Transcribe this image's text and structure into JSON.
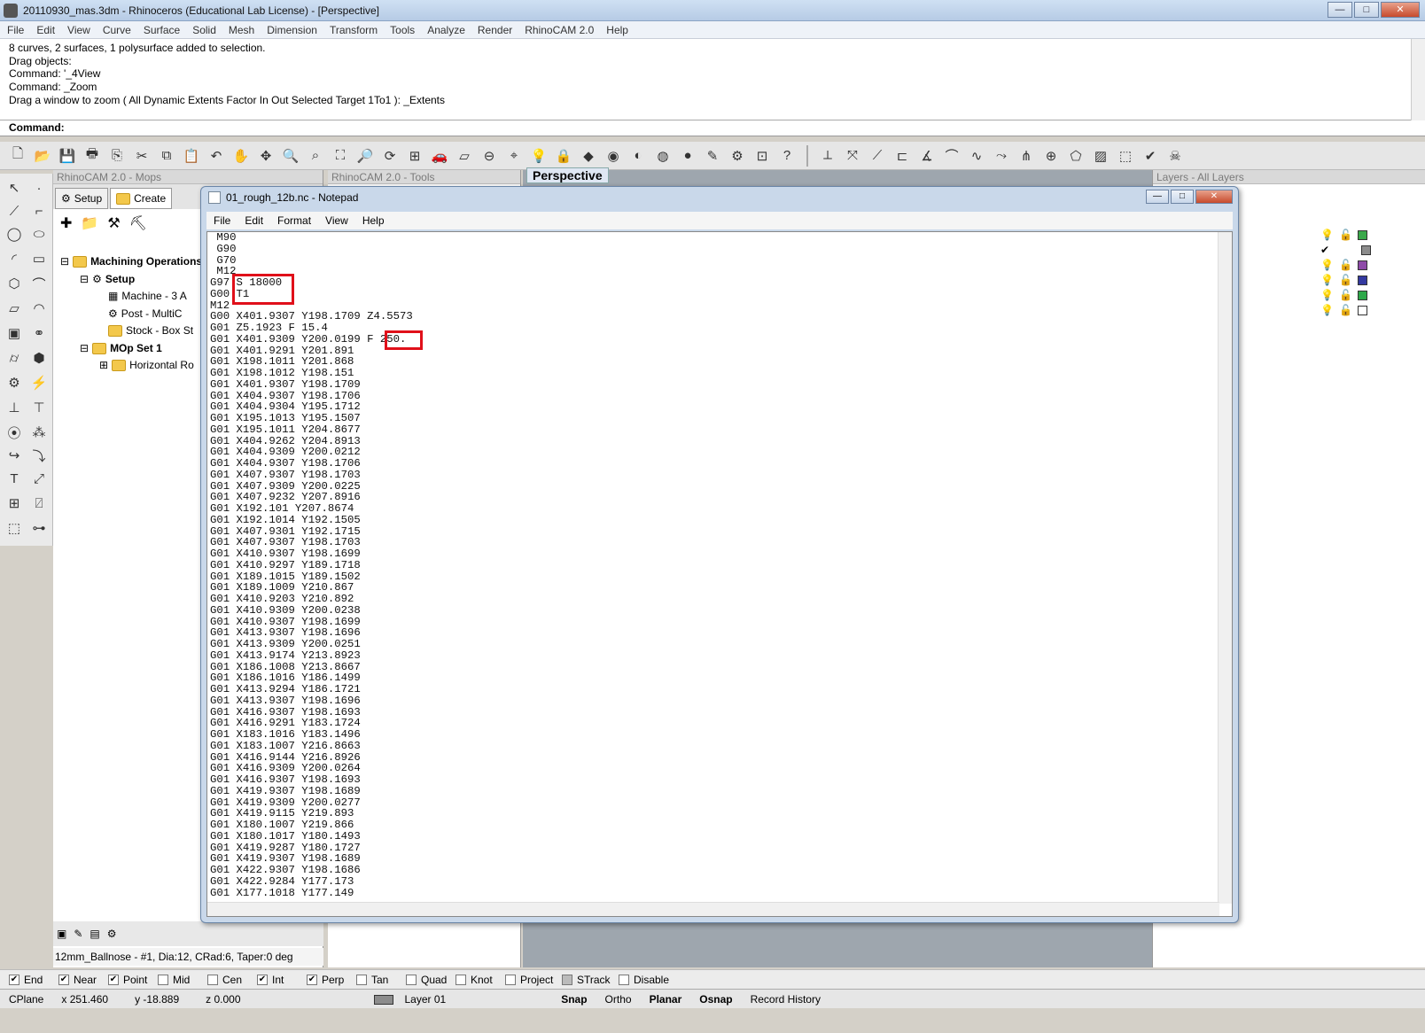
{
  "window": {
    "title": "20110930_mas.3dm - Rhinoceros (Educational Lab License) - [Perspective]",
    "min": "—",
    "max": "□",
    "close": "✕"
  },
  "menu": [
    "File",
    "Edit",
    "View",
    "Curve",
    "Surface",
    "Solid",
    "Mesh",
    "Dimension",
    "Transform",
    "Tools",
    "Analyze",
    "Render",
    "RhinoCAM 2.0",
    "Help"
  ],
  "history": [
    "8 curves, 2 surfaces, 1 polysurface added to selection.",
    "Drag objects:",
    "Command: '_4View",
    "Command: _Zoom",
    "Drag a window to zoom ( All  Dynamic  Extents  Factor  In  Out  Selected  Target  1To1 ): _Extents"
  ],
  "command_label": "Command:",
  "panels": {
    "mops": "RhinoCAM 2.0 - Mops",
    "tools": "RhinoCAM 2.0 - Tools",
    "layers": "Layers - All Layers",
    "viewport": "Perspective"
  },
  "mops_tabs": [
    "Setup",
    "Create"
  ],
  "tree": [
    {
      "label": "Machining Operations",
      "bold": true
    },
    {
      "label": "Setup",
      "bold": true
    },
    {
      "label": "Machine - 3 A"
    },
    {
      "label": "Post - MultiC"
    },
    {
      "label": "Stock - Box St"
    },
    {
      "label": "MOp Set 1",
      "bold": true
    },
    {
      "label": "Horizontal Ro"
    }
  ],
  "tool_info": "12mm_Ballnose - #1, Dia:12, CRad:6, Taper:0 deg",
  "notepad": {
    "title": "01_rough_12b.nc - Notepad",
    "menu": [
      "File",
      "Edit",
      "Format",
      "View",
      "Help"
    ],
    "lines": [
      " M90",
      " G90",
      " G70",
      " M12",
      "G97 S 18000",
      "G00 T1",
      "M12",
      "G00 X401.9307 Y198.1709 Z4.5573",
      "G01 Z5.1923 F 15.4",
      "G01 X401.9309 Y200.0199 F 250.",
      "G01 X401.9291 Y201.891",
      "G01 X198.1011 Y201.868",
      "G01 X198.1012 Y198.151",
      "G01 X401.9307 Y198.1709",
      "G01 X404.9307 Y198.1706",
      "G01 X404.9304 Y195.1712",
      "G01 X195.1013 Y195.1507",
      "G01 X195.1011 Y204.8677",
      "G01 X404.9262 Y204.8913",
      "G01 X404.9309 Y200.0212",
      "G01 X404.9307 Y198.1706",
      "G01 X407.9307 Y198.1703",
      "G01 X407.9309 Y200.0225",
      "G01 X407.9232 Y207.8916",
      "G01 X192.101 Y207.8674",
      "G01 X192.1014 Y192.1505",
      "G01 X407.9301 Y192.1715",
      "G01 X407.9307 Y198.1703",
      "G01 X410.9307 Y198.1699",
      "G01 X410.9297 Y189.1718",
      "G01 X189.1015 Y189.1502",
      "G01 X189.1009 Y210.867",
      "G01 X410.9203 Y210.892",
      "G01 X410.9309 Y200.0238",
      "G01 X410.9307 Y198.1699",
      "G01 X413.9307 Y198.1696",
      "G01 X413.9309 Y200.0251",
      "G01 X413.9174 Y213.8923",
      "G01 X186.1008 Y213.8667",
      "G01 X186.1016 Y186.1499",
      "G01 X413.9294 Y186.1721",
      "G01 X413.9307 Y198.1696",
      "G01 X416.9307 Y198.1693",
      "G01 X416.9291 Y183.1724",
      "G01 X183.1016 Y183.1496",
      "G01 X183.1007 Y216.8663",
      "G01 X416.9144 Y216.8926",
      "G01 X416.9309 Y200.0264",
      "G01 X416.9307 Y198.1693",
      "G01 X419.9307 Y198.1689",
      "G01 X419.9309 Y200.0277",
      "G01 X419.9115 Y219.893",
      "G01 X180.1007 Y219.866",
      "G01 X180.1017 Y180.1493",
      "G01 X419.9287 Y180.1727",
      "G01 X419.9307 Y198.1689",
      "G01 X422.9307 Y198.1686",
      "G01 X422.9284 Y177.173",
      "G01 X177.1018 Y177.149"
    ]
  },
  "osnap": [
    {
      "label": "End",
      "checked": true
    },
    {
      "label": "Near",
      "checked": true
    },
    {
      "label": "Point",
      "checked": true
    },
    {
      "label": "Mid",
      "checked": false
    },
    {
      "label": "Cen",
      "checked": false
    },
    {
      "label": "Int",
      "checked": true
    },
    {
      "label": "Perp",
      "checked": true
    },
    {
      "label": "Tan",
      "checked": false
    },
    {
      "label": "Quad",
      "checked": false
    },
    {
      "label": "Knot",
      "checked": false
    },
    {
      "label": "Project",
      "checked": false
    },
    {
      "label": "STrack",
      "checked": false
    },
    {
      "label": "Disable",
      "checked": false
    }
  ],
  "status": {
    "cplane": "CPlane",
    "x": "x 251.460",
    "y": "y -18.889",
    "z": "z 0.000",
    "layer": "Layer 01",
    "snap": "Snap",
    "ortho": "Ortho",
    "planar": "Planar",
    "osnap": "Osnap",
    "record": "Record History"
  },
  "layer_colors": [
    "#3aa84a",
    "#8c8c8c",
    "#8e4aa8",
    "#343aa0",
    "#2ea84a",
    "#ffffff"
  ]
}
